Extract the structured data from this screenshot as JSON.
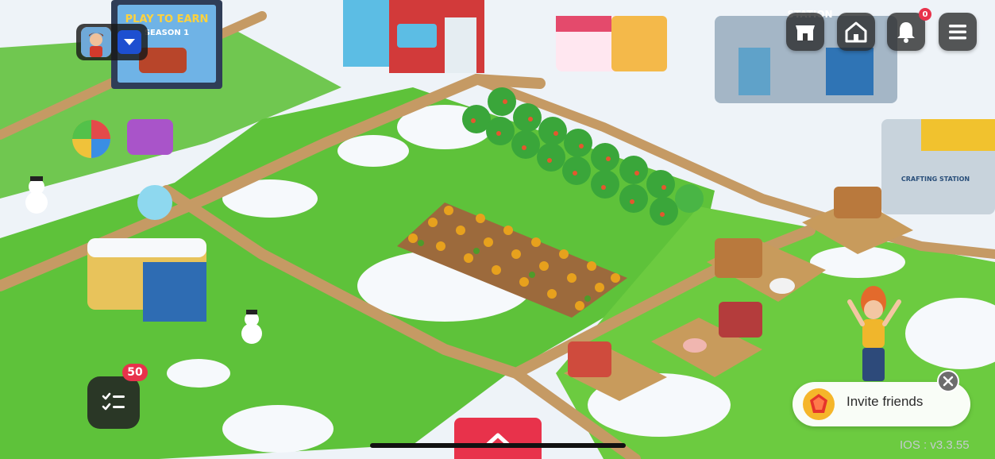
{
  "hud": {
    "notification_count": "0",
    "quests_count": "50"
  },
  "billboard": {
    "line1": "PLAY TO EARN",
    "line2": "SEASON 1"
  },
  "signs": {
    "station_top": "STATION",
    "crafting_station": "CRAFTING STATION"
  },
  "invite": {
    "label": "Invite friends"
  },
  "footer": {
    "version": "IOS : v3.3.55"
  },
  "colors": {
    "accent_red": "#e8324b",
    "dropdown_blue": "#1d4fd0",
    "hud_dark": "#2b2b2b",
    "grass": "#5ec23a",
    "snow": "#f4f7fb",
    "path": "#c59a64"
  }
}
